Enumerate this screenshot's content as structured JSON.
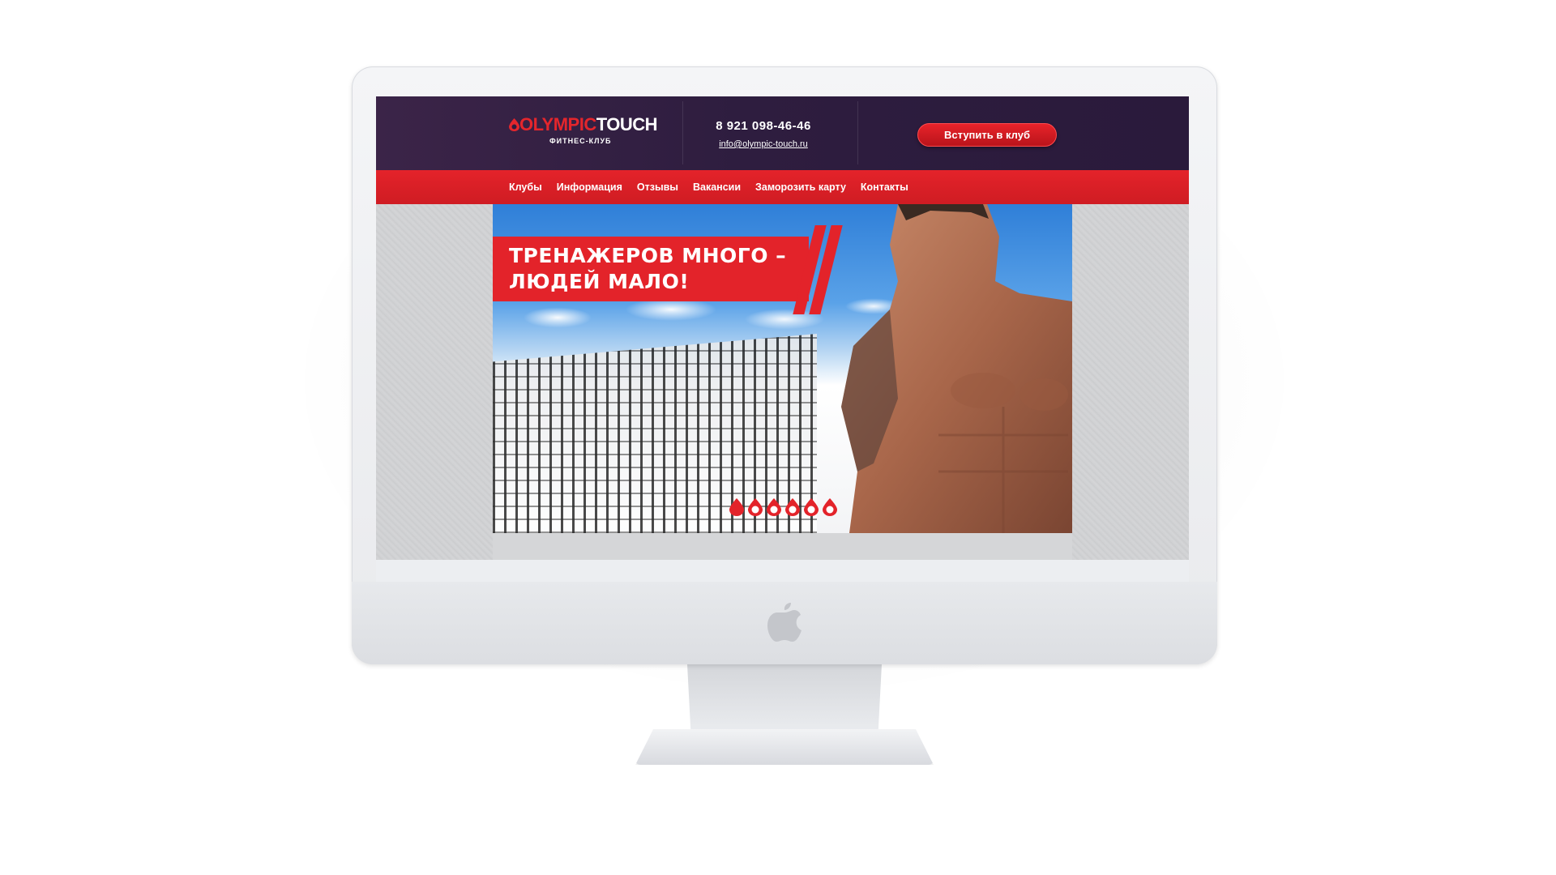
{
  "site": {
    "logo": {
      "word_left": "OLYMPIC",
      "word_right": "TOUCH",
      "subtitle": "ФИТНЕС-КЛУБ"
    },
    "header": {
      "phone": "8 921 098-46-46",
      "email": "info@olympic-touch.ru",
      "cta_label": "Вступить в клуб"
    },
    "nav": {
      "items": [
        {
          "label": "Клубы"
        },
        {
          "label": "Информация"
        },
        {
          "label": "Отзывы"
        },
        {
          "label": "Вакансии"
        },
        {
          "label": "Заморозить карту"
        },
        {
          "label": "Контакты"
        }
      ]
    },
    "hero": {
      "headline_line1": "ТРЕНАЖЕРОВ МНОГО –",
      "headline_line2": "ЛЮДЕЙ МАЛО!",
      "slide_count": 6,
      "active_slide": 1
    }
  },
  "colors": {
    "brand_red": "#e3232a",
    "header_purple": "#2e1d3f",
    "text_white": "#ffffff"
  },
  "icons": [
    "apple-logo-icon",
    "drop-icon"
  ]
}
